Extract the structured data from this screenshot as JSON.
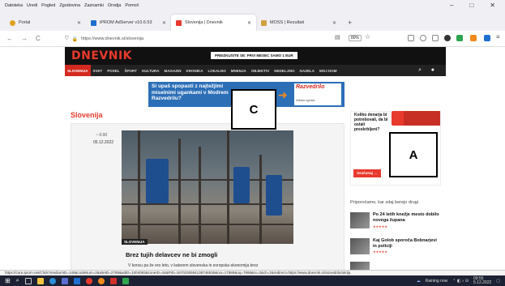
{
  "menubar": [
    "Datoteka",
    "Uredi",
    "Pogled",
    "Zgodovina",
    "Zaznamki",
    "Orodja",
    "Pomoč"
  ],
  "window_controls": [
    "–",
    "□",
    "✕"
  ],
  "tabs": [
    {
      "label": "Portal",
      "active": false,
      "color": "#e0a020"
    },
    {
      "label": "iPROM AdServer v10.6.53",
      "active": false,
      "color": "#1e6fd0"
    },
    {
      "label": "Slovenija | Dnevnik",
      "active": true,
      "color": "#e8392d"
    },
    {
      "label": "MOSS | Rezultati",
      "active": false,
      "color": "#d0a040"
    }
  ],
  "new_tab": "+",
  "nav": {
    "back": "←",
    "forward": "→",
    "reload": "C"
  },
  "url": "https://www.dnevnik.si/slovenija",
  "zoom": "80%",
  "site": {
    "logo": "DNEVNIK",
    "promo": "PREIZKUSITE SE: PRVI MESEC SAMO 1 EUR",
    "nav_items": [
      "SLOVENIJA",
      "SVET",
      "POSEL",
      "ŠPORT",
      "KULTURA",
      "MAGAZIN",
      "KRONIKA",
      "LOKALNO",
      "MNENJA",
      "OBJEKTIV",
      "NEDELJSKI",
      "GAZELA",
      "MOJ DOM"
    ],
    "nav_active_index": 0,
    "nav_search_icon": "search-icon",
    "nav_user_icon": "user-icon"
  },
  "ad_banner": {
    "text": "Si upaš spopasti z najtežjimi miselnimi ugankami v Modrem Razvedrilu?",
    "brand": "Razvedrilo",
    "tagline": "Mikaila uganka"
  },
  "section_title": "Slovenija",
  "article": {
    "time": "6:00",
    "date": "05.12.2022",
    "photo_tag": "SLOVENIJA",
    "headline": "Brez tujih delavcev ne bi zmogli",
    "lede": "V koncu pa že ero leto, v katerem slovenska in evropska ekonomija brez"
  },
  "side_ad": {
    "text": "Koliko denarja bi potrebovali, da bi ostali preskrbljeni?",
    "button": "Izračunaj →"
  },
  "recommended": {
    "title": "Priporočamo, kar zdaj berejo drugi",
    "items": [
      {
        "title": "Po 24 letih knežje mesto dobilo novega župana",
        "stars": "★★★★★"
      },
      {
        "title": "Kaj Golob sporoča Bobnarjevi in policiji",
        "stars": "★★★★★"
      }
    ]
  },
  "labels": {
    "a": "A",
    "c": "C"
  },
  "status_url": "https://core.iprom.net/Click?mediumID=140&codeNum=2&siteID=2788&adID=1004093&zoneID=44&PID=1670230584138746536&rxx=17888&oq=7898&rx=2&ch=2&redirect=https://www.dnevnik.si/razvedrilo/ukrija",
  "taskbar": {
    "weather": "Raining now",
    "time": "09:55",
    "date": "5.12.2022"
  }
}
